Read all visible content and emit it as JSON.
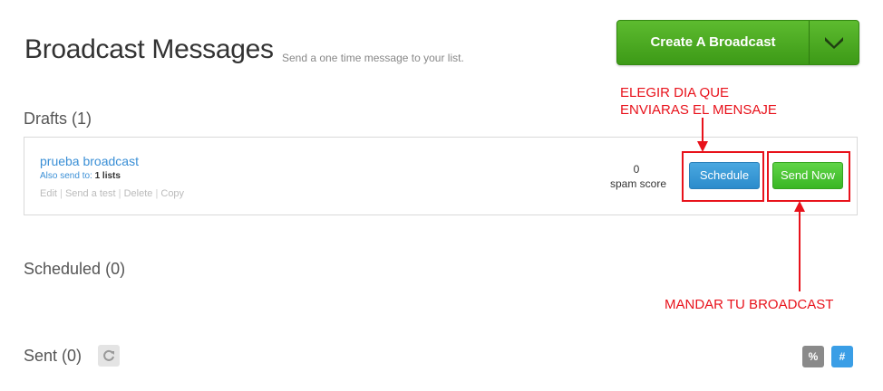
{
  "header": {
    "title": "Broadcast Messages",
    "subtitle": "Send a one time message to your list.",
    "create_button_label": "Create A Broadcast",
    "dropdown_icon": "chevron-down-icon"
  },
  "drafts": {
    "title": "Drafts (1)",
    "items": [
      {
        "name": "prueba broadcast",
        "also_send_prefix": "Also send to:",
        "also_send_value": "1 lists",
        "actions": [
          "Edit",
          "Send a test",
          "Delete",
          "Copy"
        ],
        "spam_score_value": "0",
        "spam_score_label": "spam score",
        "schedule_label": "Schedule",
        "send_now_label": "Send Now"
      }
    ]
  },
  "scheduled": {
    "title": "Scheduled (0)"
  },
  "sent": {
    "title": "Sent (0)",
    "refresh_icon": "refresh-icon",
    "percent_label": "%",
    "hash_label": "#"
  },
  "annotations": {
    "schedule_note_line1": "ELEGIR DIA QUE",
    "schedule_note_line2": "ENVIARAS EL MENSAJE",
    "send_note": "MANDAR TU BROADCAST",
    "color": "#e8121b"
  },
  "colors": {
    "green": "#4aaa22",
    "blue": "#3a9ee6",
    "link": "#3a8fd6"
  }
}
